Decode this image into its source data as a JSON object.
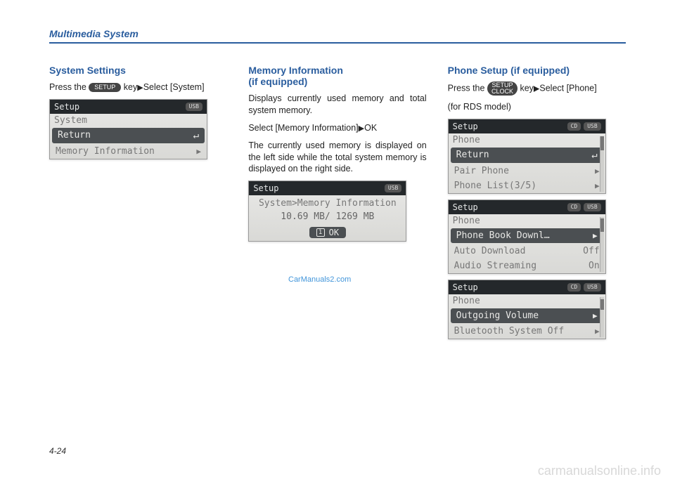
{
  "header": {
    "section_title": "Multimedia System"
  },
  "page_number": "4-24",
  "watermarks": {
    "small": "CarManuals2.com",
    "footer": "carmanualsonline.info"
  },
  "keys": {
    "setup": "SETUP",
    "setup_clock_l1": "SETUP",
    "setup_clock_l2": "CLOCK"
  },
  "col1": {
    "title": "System Settings",
    "para_before": "Press  the",
    "para_key_after": "key",
    "para_after": "Select [System]"
  },
  "col2": {
    "title1": "Memory Information",
    "title2": "(if equipped)",
    "p1": "Displays currently used memory and total system memory.",
    "p2_before": "Select [Memory Information]",
    "p2_after": "OK",
    "p3": "The currently used memory is displayed on the left side while the total system memory is displayed on the right side."
  },
  "col3": {
    "title": "Phone Setup (if equipped)",
    "p1_before": "Press the",
    "p1_mid": "key",
    "p1_after": "Select [Phone]",
    "p2": "(for RDS model)"
  },
  "screens": {
    "setup_label": "Setup",
    "usb_tab": "USB",
    "cd_tab": "CD",
    "s1": {
      "section": "System",
      "row_return": "Return",
      "row_memory": "Memory Information"
    },
    "s2": {
      "breadcrumb": "System>Memory Information",
      "value": "10.69 MB/ 1269 MB",
      "ok_num": "1",
      "ok_label": "OK"
    },
    "s3a": {
      "section": "Phone",
      "row_return": "Return",
      "row_pair": "Pair Phone",
      "row_list": "Phone List(3/5)"
    },
    "s3b": {
      "section": "Phone",
      "row_book": "Phone Book Downl…",
      "row_auto": "Auto Download",
      "row_auto_val": "Off",
      "row_stream": "Audio Streaming",
      "row_stream_val": "On"
    },
    "s3c": {
      "section": "Phone",
      "row_out": "Outgoing Volume",
      "row_btoff": "Bluetooth System Off"
    }
  }
}
